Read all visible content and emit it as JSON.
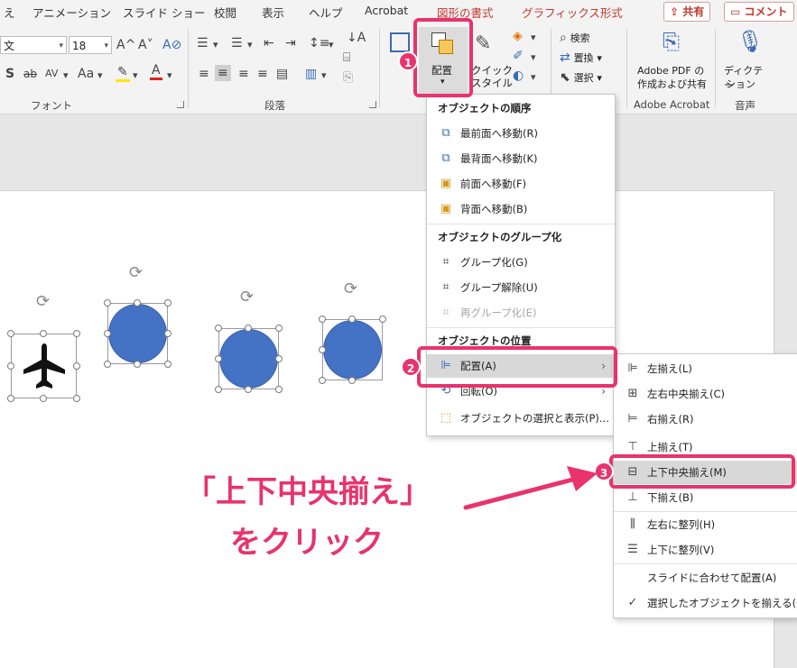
{
  "tabs": [
    "え",
    "アニメーション",
    "スライド ショー",
    "校閲",
    "表示",
    "ヘルプ",
    "Acrobat",
    "図形の書式",
    "グラフィックス形式"
  ],
  "share_button": "共有",
  "comment_button": "コメント",
  "font": {
    "name_value": "文",
    "size_value": "18",
    "grow_icon": "A^",
    "shrink_icon": "A˅",
    "clear_format_icon": "A⊘",
    "shadow_label": "S",
    "strike_label": "ab",
    "spacing_label": "AV",
    "case_label": "Aa",
    "group_label": "フォント"
  },
  "paragraph": {
    "group_label": "段落"
  },
  "arrange": {
    "label": "配置",
    "quickstyle_label_line1": "クイック",
    "quickstyle_label_line2": "スタイル"
  },
  "editing": {
    "find_label": "検索",
    "replace_label": "置換",
    "select_label": "選択"
  },
  "adobe": {
    "button_line1": "Adobe PDF の",
    "button_line2": "作成および共有",
    "group_label": "Adobe Acrobat"
  },
  "voice": {
    "button_line1": "ディクテー",
    "button_line2": "ション",
    "group_label": "音声"
  },
  "menu_arrange": {
    "order_header": "オブジェクトの順序",
    "order_items": [
      {
        "label": "最前面へ移動(R)",
        "icon": "bring-front-icon"
      },
      {
        "label": "最背面へ移動(K)",
        "icon": "send-back-icon"
      },
      {
        "label": "前面へ移動(F)",
        "icon": "bring-forward-icon"
      },
      {
        "label": "背面へ移動(B)",
        "icon": "send-backward-icon"
      }
    ],
    "group_header": "オブジェクトのグループ化",
    "group_items": [
      {
        "label": "グループ化(G)",
        "icon": "group-icon",
        "disabled": false
      },
      {
        "label": "グループ解除(U)",
        "icon": "ungroup-icon",
        "disabled": false
      },
      {
        "label": "再グループ化(E)",
        "icon": "regroup-icon",
        "disabled": true
      }
    ],
    "position_header": "オブジェクトの位置",
    "position_items": [
      {
        "label": "配置(A)",
        "icon": "align-icon",
        "has_submenu": true
      },
      {
        "label": "回転(O)",
        "icon": "rotate-icon",
        "has_submenu": true
      },
      {
        "label": "オブジェクトの選択と表示(P)...",
        "icon": "selection-pane-icon",
        "has_submenu": false
      }
    ]
  },
  "menu_align": {
    "items": [
      {
        "label": "左揃え(L)",
        "icon": "align-left-icon"
      },
      {
        "label": "左右中央揃え(C)",
        "icon": "align-center-icon"
      },
      {
        "label": "右揃え(R)",
        "icon": "align-right-icon"
      },
      {
        "label": "上揃え(T)",
        "icon": "align-top-icon"
      },
      {
        "label": "上下中央揃え(M)",
        "icon": "align-middle-icon"
      },
      {
        "label": "下揃え(B)",
        "icon": "align-bottom-icon"
      },
      {
        "label": "左右に整列(H)",
        "icon": "distribute-horizontal-icon"
      },
      {
        "label": "上下に整列(V)",
        "icon": "distribute-vertical-icon"
      },
      {
        "label": "スライドに合わせて配置(A)",
        "icon": ""
      },
      {
        "label": "選択したオブジェクトを揃える(O)",
        "icon": "check-icon"
      }
    ]
  },
  "callouts": {
    "step1": "1",
    "step2": "2",
    "step3": "3",
    "caption_line1": "「上下中央揃え」",
    "caption_line2": "をクリック"
  },
  "colors": {
    "accent": "#e8336d",
    "shape_fill": "#4472c4",
    "context_tab": "#c0392b"
  }
}
